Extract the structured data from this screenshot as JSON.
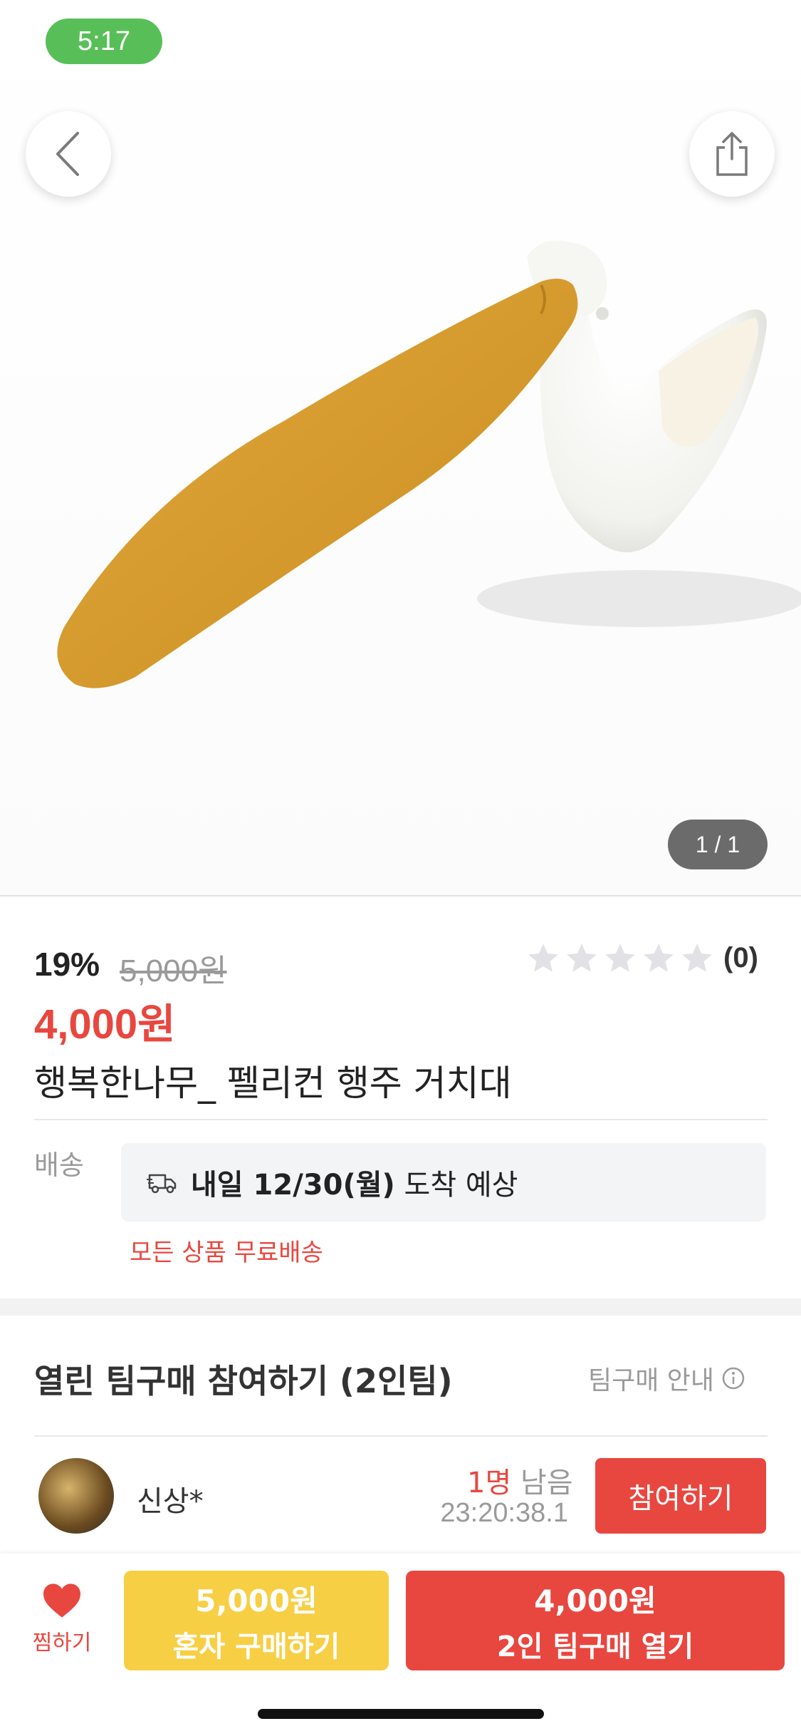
{
  "status": {
    "time": "5:17"
  },
  "gallery": {
    "counter": "1 / 1"
  },
  "product": {
    "discount": "19%",
    "original_price": "5,000원",
    "price": "4,000원",
    "rating_count": "(0)",
    "rating_value": 0,
    "title": "행복한나무_ 펠리컨 행주 거치대"
  },
  "shipping": {
    "label": "배송",
    "arrival_bold": "내일 12/30(월)",
    "arrival_rest": " 도착 예상",
    "free_notice": "모든 상품 무료배송"
  },
  "team": {
    "title": "열린 팀구매 참여하기 (2인팀)",
    "guide_label": "팀구매 안내",
    "entry": {
      "user": "신상*",
      "remain_count": "1명",
      "remain_label": " 남음",
      "timer": "23:20:38.1",
      "join_label": "참여하기"
    }
  },
  "bottom": {
    "wish_label": "찜하기",
    "alone_price": "5,000원",
    "alone_label": "혼자 구매하기",
    "team_price": "4,000원",
    "team_label": "2인 팀구매 열기"
  },
  "colors": {
    "accent": "#e8473f",
    "yellow": "#f7cf45",
    "status_green": "#58bf58"
  }
}
